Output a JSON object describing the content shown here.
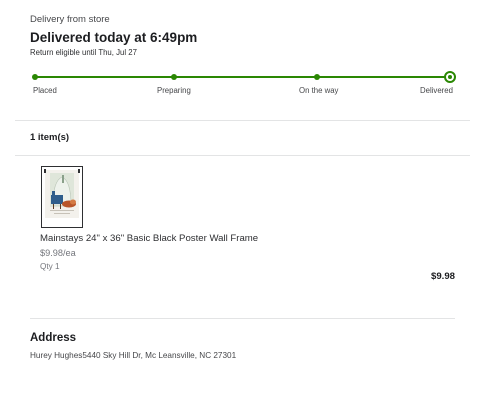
{
  "header": {
    "delivery_mode": "Delivery from store",
    "status_title": "Delivered today at 6:49pm",
    "return_note": "Return eligible until Thu, Jul 27"
  },
  "tracker": {
    "steps": [
      "Placed",
      "Preparing",
      "On the way",
      "Delivered"
    ],
    "current_step": "Delivered",
    "accent_color": "#2a8703"
  },
  "items": {
    "count_label": "1 item(s)",
    "list": [
      {
        "name": "Mainstays 24\" x 36\" Basic Black Poster Wall Frame",
        "unit_price": "$9.98/ea",
        "qty": "Qty 1",
        "total": "$9.98",
        "image_icon": "poster-frame-image"
      }
    ]
  },
  "address": {
    "heading": "Address",
    "line": "Hurey Hughes5440 Sky Hill Dr, Mc Leansville, NC 27301"
  }
}
